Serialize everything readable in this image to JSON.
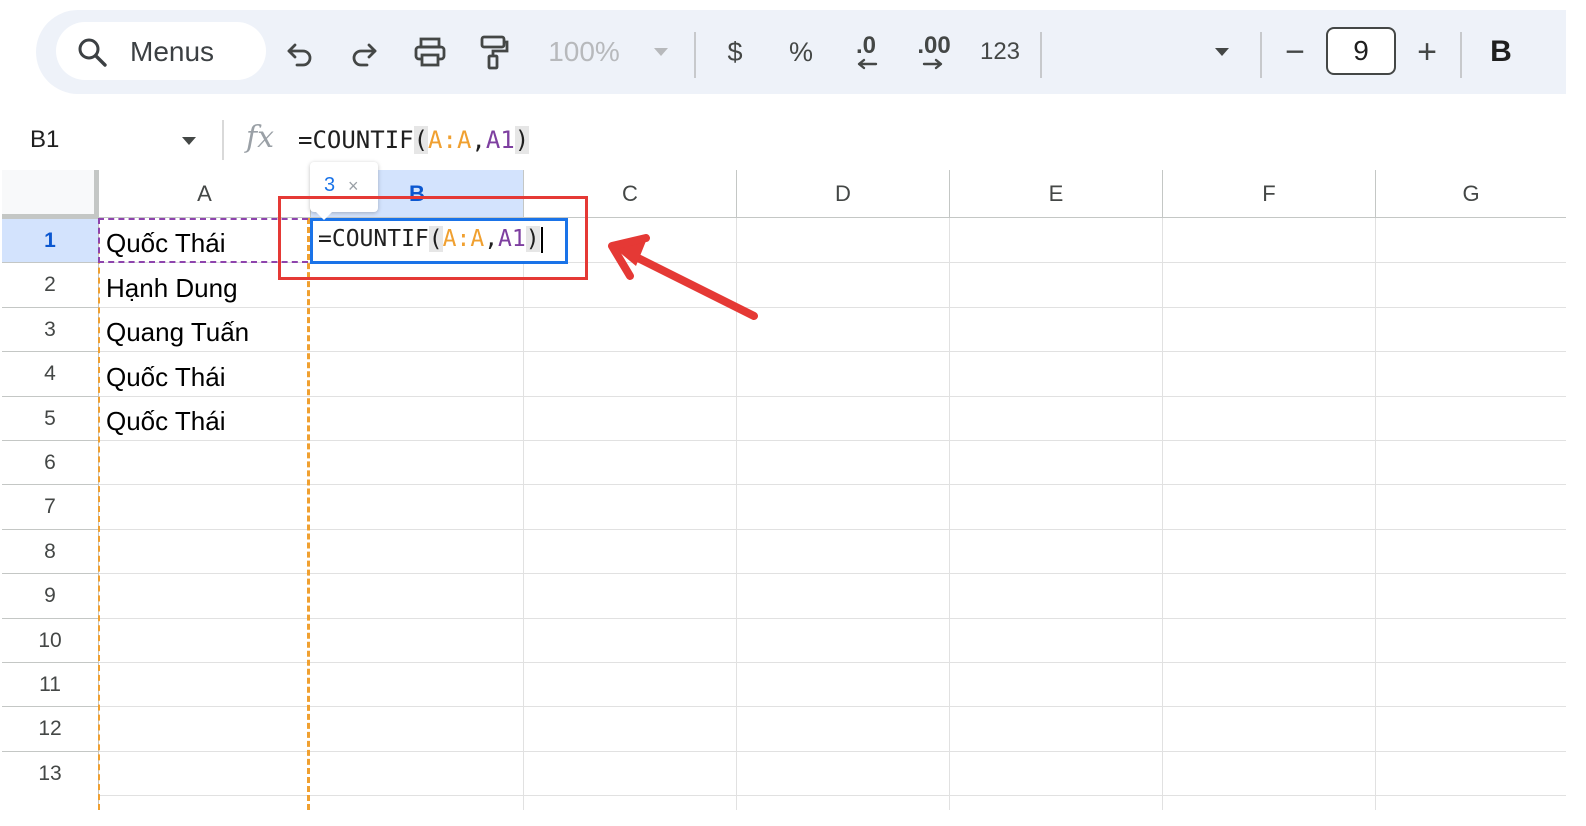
{
  "toolbar": {
    "search_label": "Menus",
    "zoom": "100%",
    "currency": "$",
    "percent": "%",
    "decrease_decimal": ".0",
    "increase_decimal": ".00",
    "number_format": "123",
    "font_size": "9",
    "minus": "−",
    "plus": "+",
    "bold": "B"
  },
  "formula_bar": {
    "cell_ref": "B1",
    "fx": "fx",
    "formula": {
      "prefix": "=COUNTIF",
      "open": "(",
      "range": "A:A",
      "comma": ",",
      "ref": "A1",
      "close": ")"
    }
  },
  "grid": {
    "columns": [
      "A",
      "B",
      "C",
      "D",
      "E",
      "F",
      "G"
    ],
    "selected_column": "B",
    "rows": [
      "1",
      "2",
      "3",
      "4",
      "5",
      "6",
      "7",
      "8",
      "9",
      "10",
      "11",
      "12",
      "13"
    ],
    "selected_row": "1",
    "column_a_values": [
      "Quốc Thái",
      "Hạnh Dung",
      "Quang Tuấn",
      "Quốc Thái",
      "Quốc Thái"
    ],
    "preview_value": "3",
    "preview_close": "×"
  },
  "colors": {
    "accent": "#1a73e8",
    "selected_header": "#d3e3fd",
    "annotation": "#e53935",
    "range_orange": "#f0a030",
    "range_purple": "#8e44ad"
  }
}
